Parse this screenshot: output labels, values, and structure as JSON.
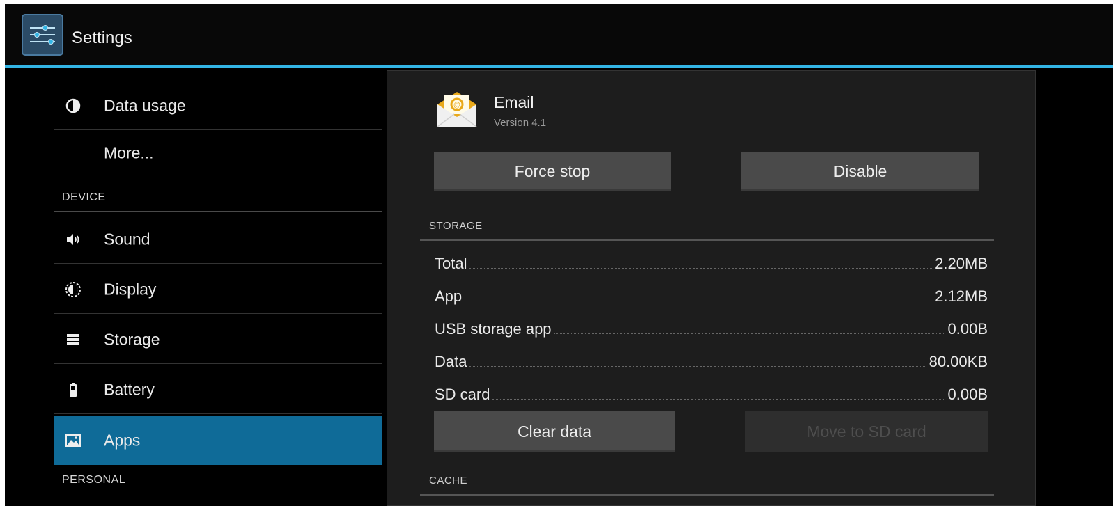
{
  "actionbar": {
    "title": "Settings"
  },
  "sidebar": {
    "items_top": [
      {
        "label": "Data usage",
        "icon": "data-usage-icon"
      },
      {
        "label": "More..."
      }
    ],
    "device_header": "DEVICE",
    "device_items": [
      {
        "label": "Sound",
        "icon": "sound-icon"
      },
      {
        "label": "Display",
        "icon": "display-icon"
      },
      {
        "label": "Storage",
        "icon": "storage-icon"
      },
      {
        "label": "Battery",
        "icon": "battery-icon"
      },
      {
        "label": "Apps",
        "icon": "apps-icon",
        "selected": true
      }
    ],
    "personal_header": "PERSONAL"
  },
  "detail": {
    "app_name": "Email",
    "app_version": "Version 4.1",
    "force_stop_label": "Force stop",
    "disable_label": "Disable",
    "storage_header": "STORAGE",
    "storage": [
      {
        "label": "Total",
        "value": "2.20MB"
      },
      {
        "label": "App",
        "value": "2.12MB"
      },
      {
        "label": "USB storage app",
        "value": "0.00B"
      },
      {
        "label": "Data",
        "value": "80.00KB"
      },
      {
        "label": "SD card",
        "value": "0.00B"
      }
    ],
    "clear_data_label": "Clear data",
    "move_sd_label": "Move to SD card",
    "cache_header": "CACHE"
  },
  "colors": {
    "accent": "#33b5e5",
    "selected": "#0f6b98"
  }
}
